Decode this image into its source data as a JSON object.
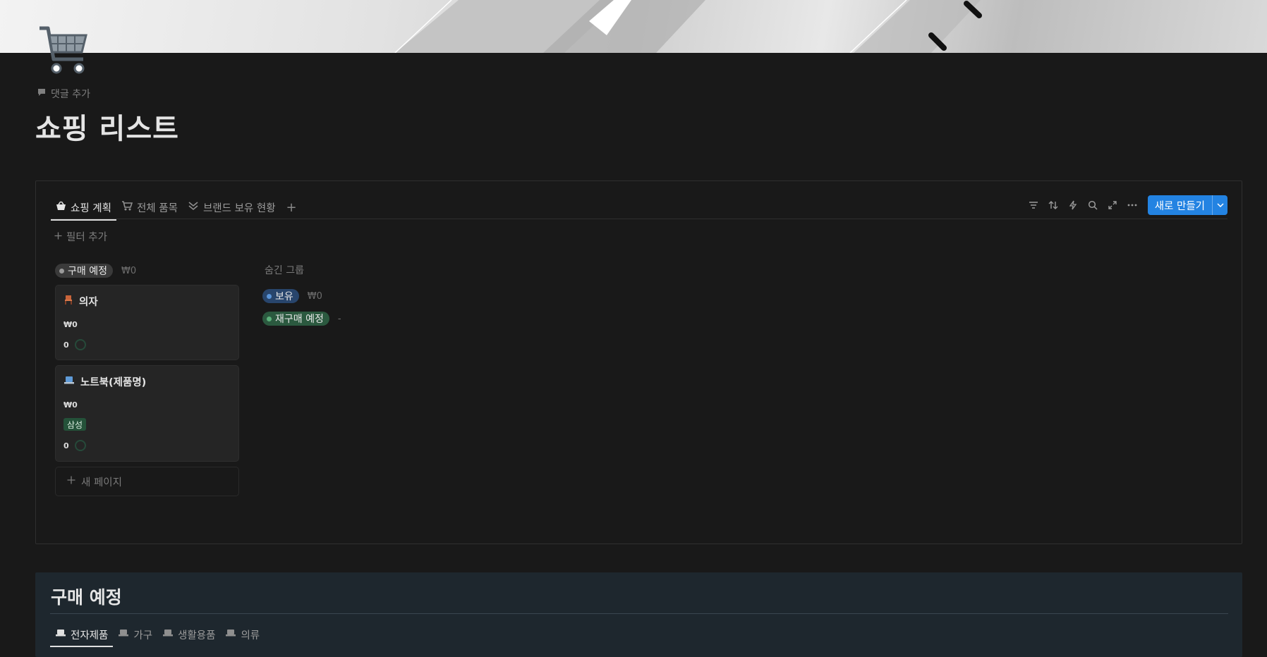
{
  "page": {
    "comment_label": "댓글 추가",
    "title": "쇼핑 리스트"
  },
  "icons": {
    "page_icon": "shopping-cart-icon",
    "comment": "comment-icon"
  },
  "database": {
    "tabs": [
      {
        "label": "쇼핑 계획",
        "icon": "basket-icon",
        "active": true
      },
      {
        "label": "전체 품목",
        "icon": "cart-icon",
        "active": false
      },
      {
        "label": "브랜드 보유 현황",
        "icon": "chevrons-down-icon",
        "active": false
      }
    ],
    "add_view": "+",
    "toolbar": [
      "filter-icon",
      "sort-icon",
      "lightning-icon",
      "search-icon",
      "expand-icon",
      "more-icon"
    ],
    "new_button": "새로 만들기",
    "filter_add": "필터 추가",
    "board": {
      "group": {
        "label": "구매 예정",
        "sum": "₩0",
        "color": "#5a5a5a"
      },
      "cards": [
        {
          "title": "의자",
          "icon": "chair-icon",
          "price": "₩0",
          "qty": "0"
        },
        {
          "title": "노트북(제품명)",
          "icon": "laptop-icon",
          "price": "₩0",
          "brand": "삼성",
          "qty": "0"
        }
      ],
      "new_page": "새 페이지",
      "hidden_groups_label": "숨긴 그룹",
      "hidden_groups": [
        {
          "label": "보유",
          "sum": "₩0",
          "bg": "#28456c",
          "dot": "#5a94d8"
        },
        {
          "label": "재구매 예정",
          "sum": "-",
          "bg": "#2b593f",
          "dot": "#5cb07a"
        }
      ]
    }
  },
  "section2": {
    "title": "구매 예정",
    "tabs": [
      {
        "label": "전자제품",
        "active": true
      },
      {
        "label": "가구",
        "active": false
      },
      {
        "label": "생활용품",
        "active": false
      },
      {
        "label": "의류",
        "active": false
      }
    ]
  }
}
